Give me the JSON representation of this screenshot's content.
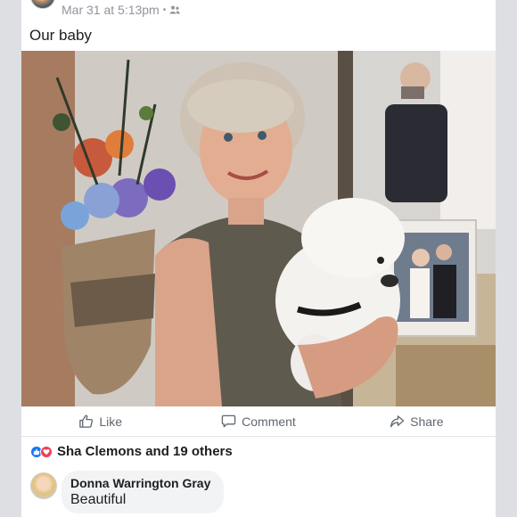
{
  "post": {
    "timestamp": "Mar 31 at 5:13pm",
    "separator": "•",
    "audience_icon": "friends-icon",
    "caption": "Our baby"
  },
  "actions": {
    "like": "Like",
    "comment": "Comment",
    "share": "Share"
  },
  "reactions": {
    "icons": [
      "like-reaction-icon",
      "love-reaction-icon"
    ],
    "summary": "Sha Clemons and 19 others"
  },
  "comment": {
    "author": "Donna Warrington Gray",
    "text": "Beautiful"
  },
  "colors": {
    "like_blue": "#1877f2",
    "love_red": "#f33e58",
    "meta_gray": "#90949c",
    "action_gray": "#606770"
  }
}
